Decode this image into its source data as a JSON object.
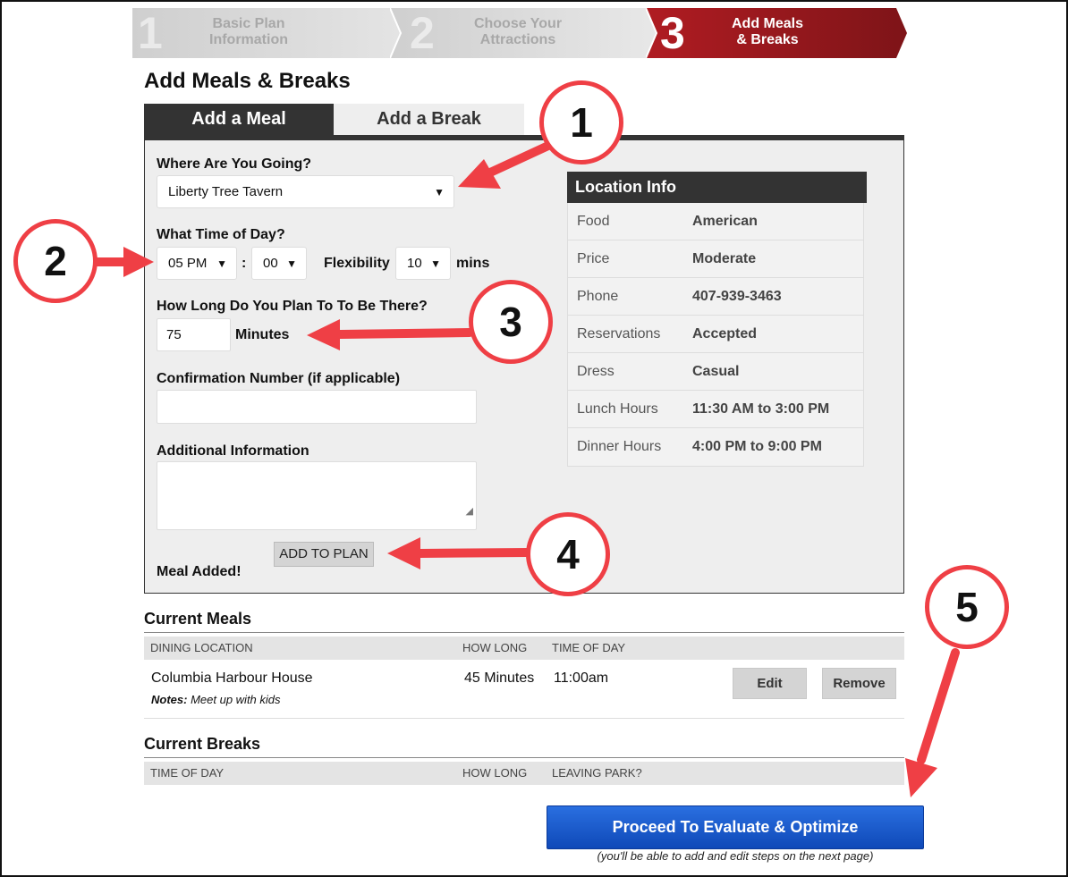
{
  "steps": [
    {
      "num": "1",
      "label_line1": "Basic Plan",
      "label_line2": "Information"
    },
    {
      "num": "2",
      "label_line1": "Choose Your",
      "label_line2": "Attractions"
    },
    {
      "num": "3",
      "label_line1": "Add Meals",
      "label_line2": "& Breaks"
    }
  ],
  "page_title": "Add Meals & Breaks",
  "tabs": {
    "meal": "Add a Meal",
    "break": "Add a Break"
  },
  "form": {
    "where_label": "Where Are You Going?",
    "where_value": "Liberty Tree Tavern",
    "time_label": "What Time of Day?",
    "hour_value": "05 PM",
    "time_sep": ":",
    "minute_value": "00",
    "flex_label": "Flexibility",
    "flex_value": "10",
    "flex_unit": "mins",
    "duration_label": "How Long Do You Plan To To Be There?",
    "duration_value": "75",
    "duration_unit": "Minutes",
    "confirm_label": "Confirmation Number (if applicable)",
    "confirm_value": "",
    "info_label": "Additional Information",
    "info_value": "",
    "add_button": "ADD TO PLAN",
    "status": "Meal Added!"
  },
  "location_info": {
    "title": "Location Info",
    "rows": [
      {
        "key": "Food",
        "value": "American"
      },
      {
        "key": "Price",
        "value": "Moderate"
      },
      {
        "key": "Phone",
        "value": "407-939-3463"
      },
      {
        "key": "Reservations",
        "value": "Accepted"
      },
      {
        "key": "Dress",
        "value": "Casual"
      },
      {
        "key": "Lunch Hours",
        "value": "11:30 AM to 3:00 PM"
      },
      {
        "key": "Dinner Hours",
        "value": "4:00 PM to 9:00 PM"
      }
    ]
  },
  "current_meals": {
    "title": "Current Meals",
    "columns": [
      "DINING LOCATION",
      "HOW LONG",
      "TIME OF DAY"
    ],
    "rows": [
      {
        "location": "Columbia Harbour House",
        "notes_label": "Notes:",
        "notes": "Meet up with kids",
        "how_long": "45 Minutes",
        "time": "11:00am",
        "edit": "Edit",
        "remove": "Remove"
      }
    ]
  },
  "current_breaks": {
    "title": "Current Breaks",
    "columns": [
      "TIME OF DAY",
      "HOW LONG",
      "LEAVING PARK?"
    ]
  },
  "proceed": {
    "label": "Proceed To Evaluate & Optimize",
    "note": "(you'll be able to add and edit steps on the next page)"
  },
  "callouts": [
    "1",
    "2",
    "3",
    "4",
    "5"
  ],
  "colors": {
    "step_active": "#a01a1f",
    "step_inactive": "#d6d6d6",
    "dark": "#333333",
    "panel": "#eeeeee",
    "callout_red": "#ef3f45",
    "proceed_blue": "#1a5bd0"
  }
}
